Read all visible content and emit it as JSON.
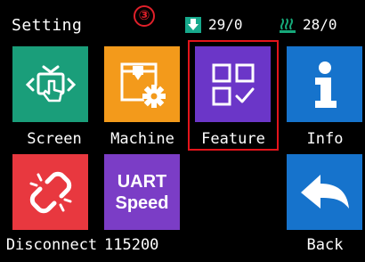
{
  "header": {
    "title": "Setting",
    "annotation_marker": "③",
    "nozzle_temp": "29/0",
    "bed_temp": "28/0"
  },
  "tiles": [
    {
      "key": "screen",
      "label": "Screen",
      "color": "#1a9e7a",
      "icon": "touch-screen-icon"
    },
    {
      "key": "machine",
      "label": "Machine",
      "color": "#f39a1b",
      "icon": "machine-gear-icon"
    },
    {
      "key": "feature",
      "label": "Feature",
      "color": "#6b36c8",
      "icon": "feature-grid-check-icon",
      "highlighted": true
    },
    {
      "key": "info",
      "label": "Info",
      "color": "#1673cc",
      "icon": "info-icon"
    },
    {
      "key": "disconnect",
      "label": "Disconnect",
      "color": "#e8383f",
      "icon": "broken-link-icon"
    },
    {
      "key": "uart",
      "label": "115200",
      "color": "#7b3dc6",
      "icon_text": "UART Speed"
    },
    {
      "key": "back",
      "label": "Back",
      "color": "#1673cc",
      "icon": "back-arrow-icon"
    }
  ],
  "colors": {
    "annotation_red": "#e0202a",
    "nozzle_icon": "#17a98c",
    "bed_icon": "#16a879"
  }
}
